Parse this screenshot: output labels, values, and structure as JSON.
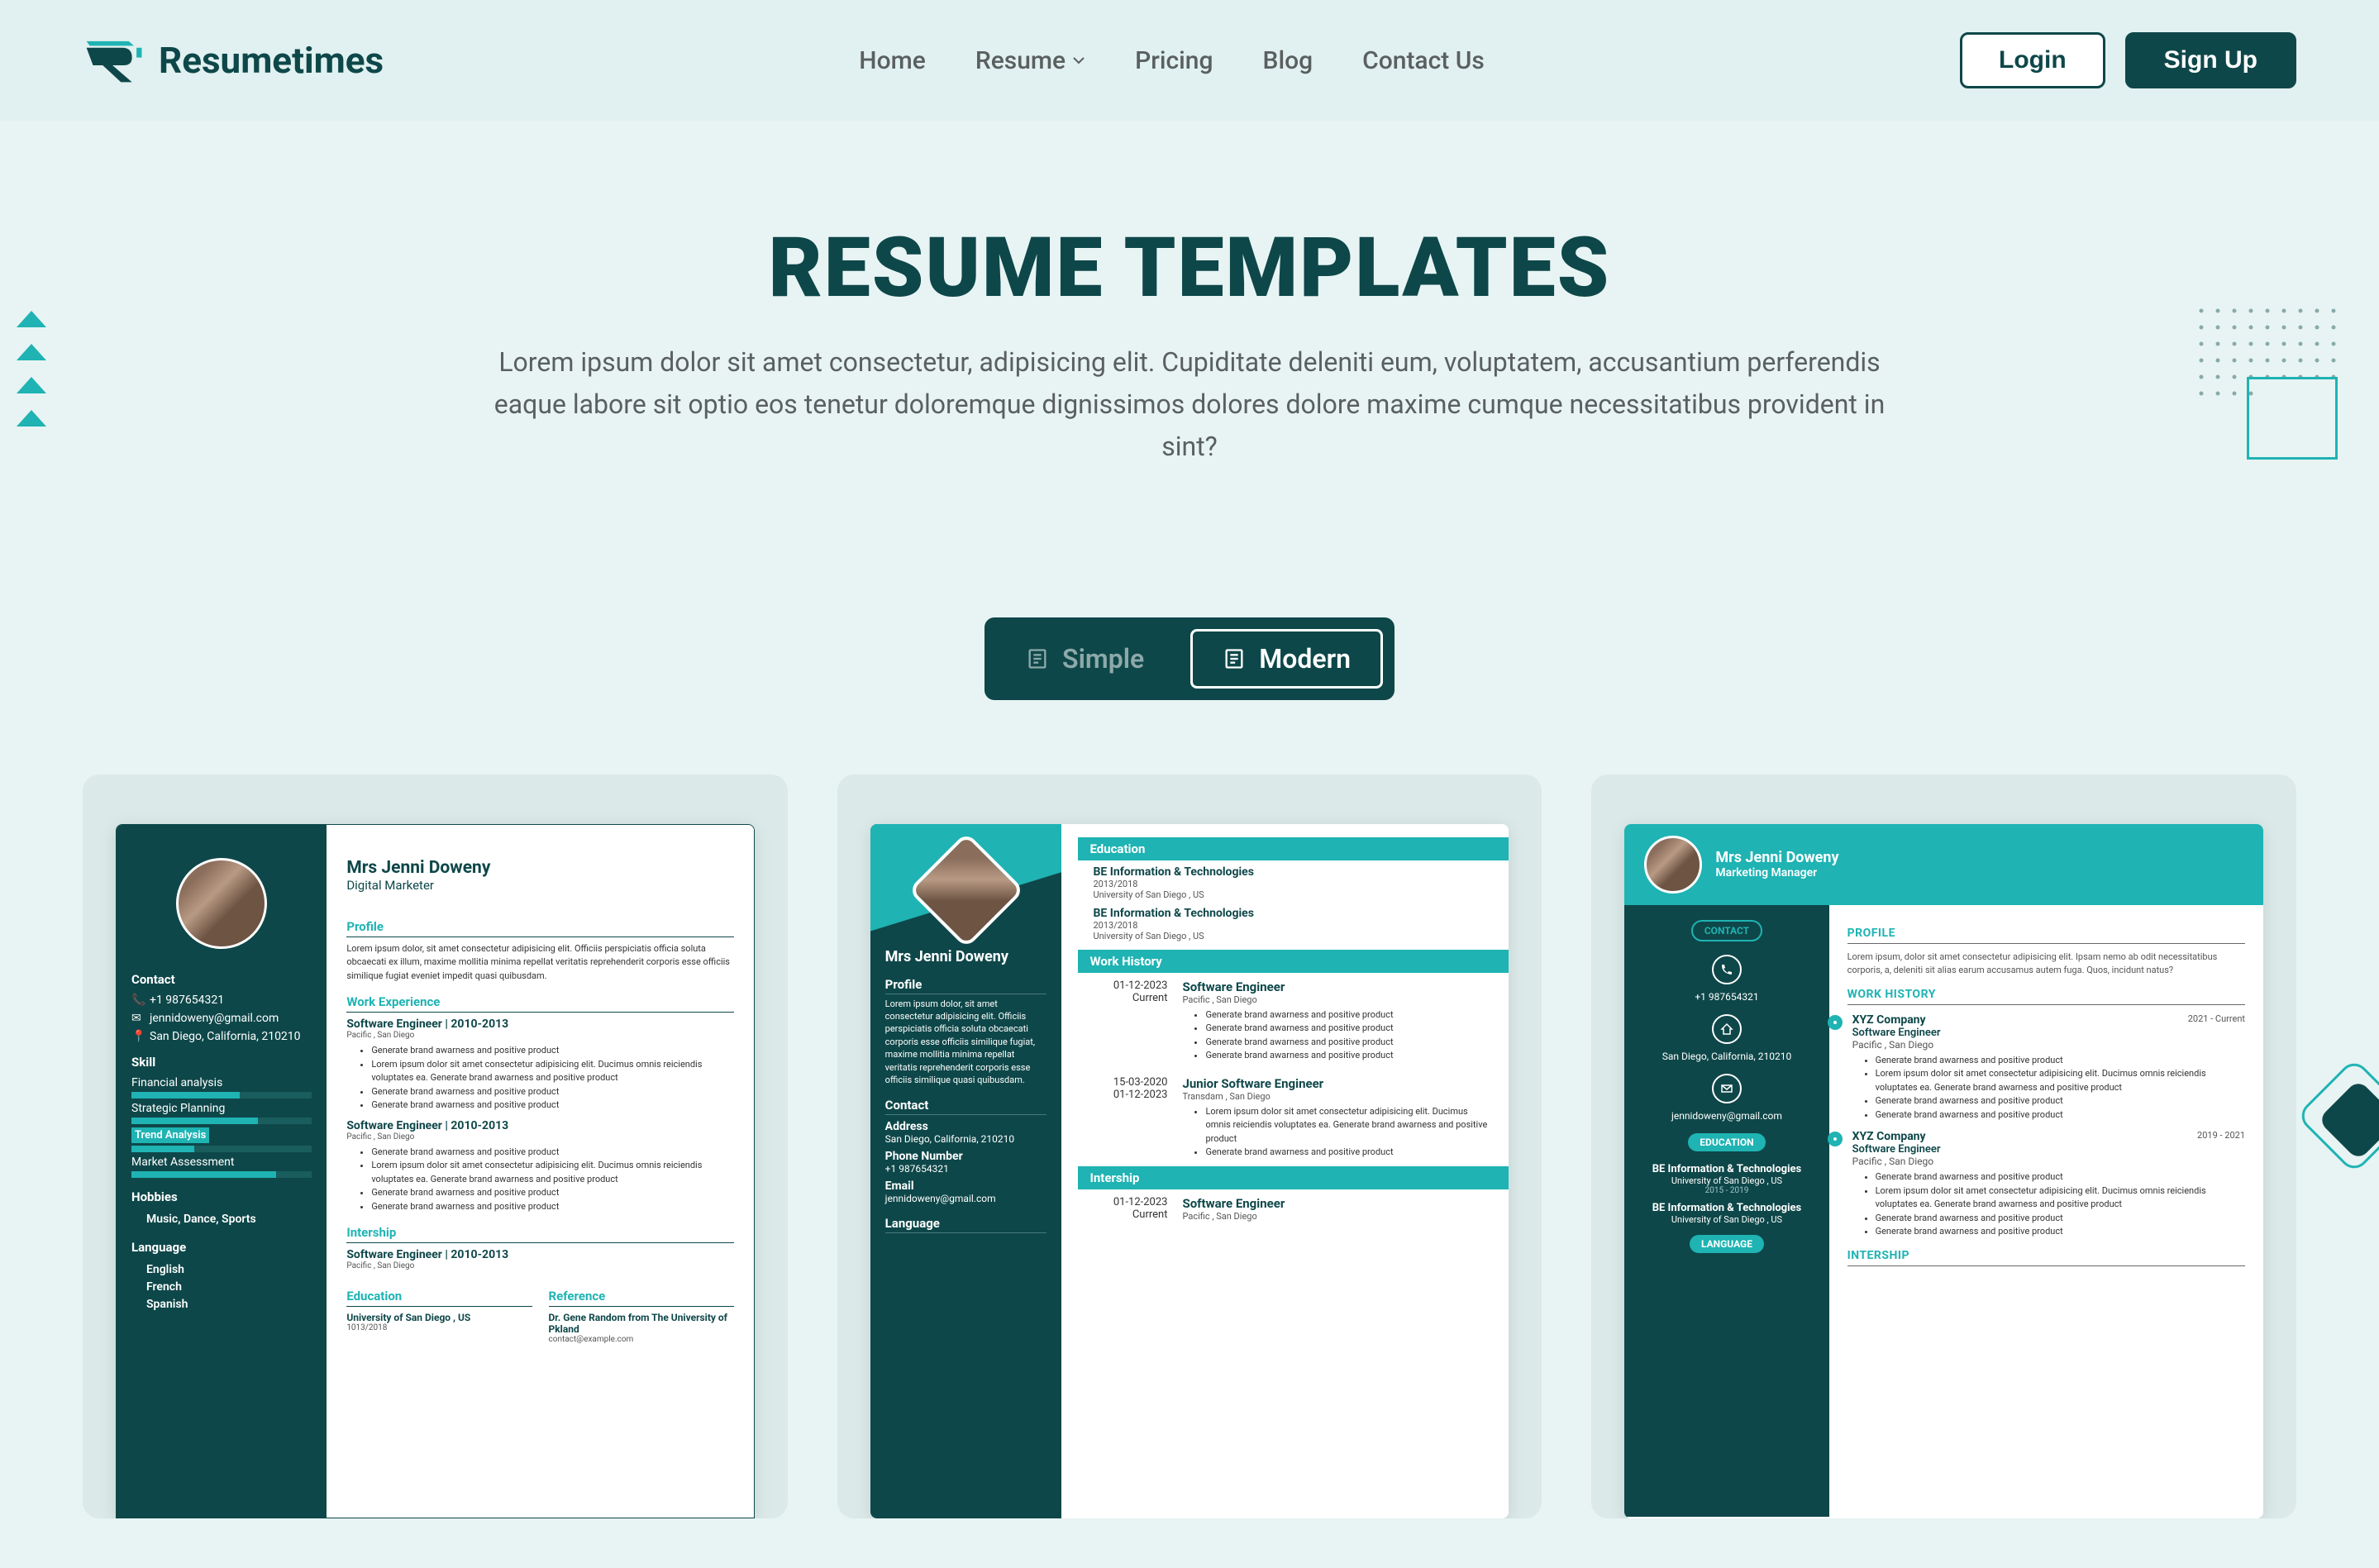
{
  "brand": "Resumetimes",
  "nav": {
    "home": "Home",
    "resume": "Resume",
    "pricing": "Pricing",
    "blog": "Blog",
    "contact": "Contact Us"
  },
  "buttons": {
    "login": "Login",
    "signup": "Sign Up"
  },
  "hero": {
    "title": "RESUME TEMPLATES",
    "desc": "Lorem ipsum dolor sit amet consectetur, adipisicing elit. Cupiditate deleniti eum, voluptatem, accusantium perferendis eaque labore sit optio eos tenetur doloremque dignissimos dolores dolore maxime cumque necessitatibus provident in sint?"
  },
  "tabs": {
    "simple": "Simple",
    "modern": "Modern"
  },
  "t1": {
    "name": "Mrs Jenni Doweny",
    "role": "Digital Marketer",
    "contact_h": "Contact",
    "phone": "+1 987654321",
    "email": "jennidoweny@gmail.com",
    "location": "San Diego, California, 210210",
    "skill_h": "Skill",
    "skills": [
      "Financial analysis",
      "Strategic Planning",
      "Trend Analysis",
      "Market Assessment"
    ],
    "hobbies_h": "Hobbies",
    "hobbies": "Music, Dance, Sports",
    "lang_h": "Language",
    "langs": [
      "English",
      "French",
      "Spanish"
    ],
    "profile_h": "Profile",
    "profile_text": "Lorem ipsum dolor, sit amet consectetur adipisicing elit. Officiis perspiciatis officia soluta obcaecati ex illum, maxime mollitia minima repellat veritatis reprehenderit corporis esse officiis similique fugiat eveniet impedit quasi quibusdam.",
    "work_h": "Work Experience",
    "job_title": "Software Engineer | 2010-2013",
    "job_loc": "Pacific , San Diego",
    "bullets": [
      "Generate brand awarness and positive product",
      "Lorem ipsum dolor sit amet consectetur adipisicing elit. Ducimus omnis reiciendis voluptates ea. Generate brand awarness and positive product",
      "Generate brand awarness and positive product",
      "Generate brand awarness and positive product"
    ],
    "bullets2": [
      "Generate brand awarness and positive product",
      "Lorem ipsum dolor sit amet consectetur adipisicing elit. Ducimus omnis reiciendis voluptates ea. Generate brand awarness and positive product",
      "Generate brand awarness and positive product",
      "Generate brand awarness and positive product"
    ],
    "intern_h": "Intership",
    "edu_h": "Education",
    "edu1": "University of San Diego , US",
    "edu1_date": "1013/2018",
    "ref_h": "Reference",
    "ref_name": "Dr. Gene Random from The University of Pkland",
    "ref_contact": "contact@example.com"
  },
  "t2": {
    "name": "Mrs Jenni Doweny",
    "profile_h": "Profile",
    "profile_text": "Lorem ipsum dolor, sit amet consectetur adipisicing elit. Officiis perspiciatis officia soluta obcaecati corporis esse officiis similique fugiat, maxime mollitia minima repellat veritatis reprehenderit corporis esse officiis similique quasi quibusdam.",
    "contact_h": "Contact",
    "addr_l": "Address",
    "addr": "San Diego, California, 210210",
    "phone_l": "Phone Number",
    "phone": "+1 987654321",
    "email_l": "Email",
    "email": "jennidoweny@gmail.com",
    "lang_h": "Language",
    "edu_h": "Education",
    "edu_t1": "BE Information & Technologies",
    "edu_d1": "2013/2018",
    "edu_l1": "University of San Diego , US",
    "edu_t2": "BE Information & Technologies",
    "edu_d2": "2013/2018",
    "edu_l2": "University of San Diego , US",
    "work_h": "Work History",
    "j1_d1": "01-12-2023",
    "j1_d2": "Current",
    "j1_t": "Software Engineer",
    "j1_l": "Pacific , San Diego",
    "j1_bullets": [
      "Generate brand awarness and positive product",
      "Generate brand awarness and positive product",
      "Generate brand awarness and positive product",
      "Generate brand awarness and positive product"
    ],
    "j2_d1": "15-03-2020",
    "j2_d2": "01-12-2023",
    "j2_t": "Junior Software Engineer",
    "j2_l": "Transdam , San Diego",
    "j2_bullets": [
      "Lorem ipsum dolor sit amet consectetur adipisicing elit. Ducimus omnis reiciendis voluptates ea. Generate brand awarness and positive product",
      "Generate brand awarness and positive product"
    ],
    "intern_h": "Intership",
    "i1_d1": "01-12-2023",
    "i1_d2": "Current",
    "i1_t": "Software Engineer",
    "i1_l": "Pacific , San Diego"
  },
  "t3": {
    "name": "Mrs Jenni Doweny",
    "role": "Marketing Manager",
    "contact_pill": "CONTACT",
    "phone": "+1 987654321",
    "location": "San Diego, California, 210210",
    "email": "jennidoweny@gmail.com",
    "edu_pill": "EDUCATION",
    "edu_t1": "BE Information & Technologies",
    "edu_l1": "University of San Diego , US",
    "edu_d1": "2015 - 2019",
    "edu_t2": "BE Information & Technologies",
    "edu_l2": "University of San Diego , US",
    "lang_pill": "LANGUAGE",
    "profile_h": "PROFILE",
    "profile_text": "Lorem ipsum, dolor sit amet consectetur adipisicing elit. Ipsam nemo ab odit necessitatibus corporis, a, deleniti sit alias earum accusamus autem fuga. Quos, incidunt natus?",
    "work_h": "WORK HISTORY",
    "j1_c": "XYZ Company",
    "j1_d": "2021 - Current",
    "j1_t": "Software Engineer",
    "j1_l": "Pacific , San Diego",
    "j1_bullets": [
      "Generate brand awarness and positive product",
      "Lorem ipsum dolor sit amet consectetur adipisicing elit. Ducimus omnis reiciendis voluptates ea. Generate brand awarness and positive product",
      "Generate brand awarness and positive product",
      "Generate brand awarness and positive product"
    ],
    "j2_c": "XYZ Company",
    "j2_d": "2019 - 2021",
    "j2_t": "Software Engineer",
    "j2_l": "Pacific , San Diego",
    "j2_bullets": [
      "Generate brand awarness and positive product",
      "Lorem ipsum dolor sit amet consectetur adipisicing elit. Ducimus omnis reiciendis voluptates ea. Generate brand awarness and positive product",
      "Generate brand awarness and positive product",
      "Generate brand awarness and positive product"
    ],
    "intern_h": "INTERSHIP"
  }
}
